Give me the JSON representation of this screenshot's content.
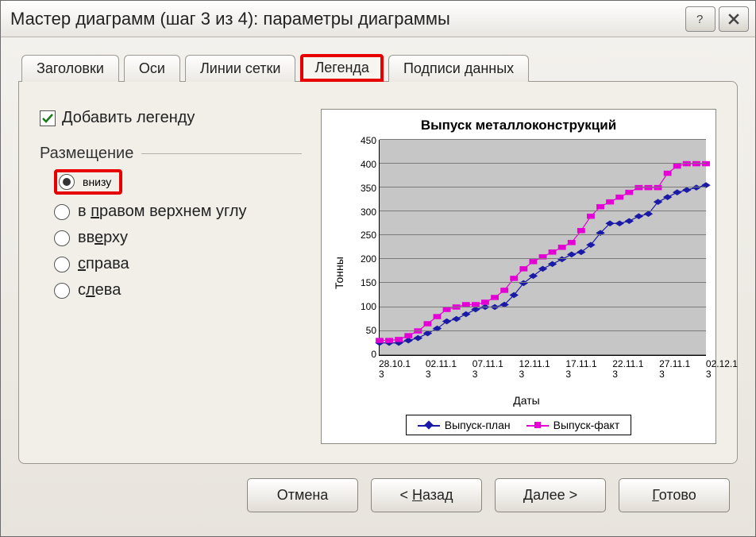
{
  "window": {
    "title": "Мастер диаграмм (шаг 3 из 4): параметры диаграммы"
  },
  "tabs": {
    "titles": "Заголовки",
    "axes": "Оси",
    "gridlines": "Линии сетки",
    "legend": "Легенда",
    "datalabels": "Подписи данных",
    "active": "legend"
  },
  "legendPanel": {
    "addLegend": "Добавить легенду",
    "placementLabel": "Размещение",
    "options": {
      "bottom": "внизу",
      "topRight": "в правом верхнем углу",
      "top": "вверху",
      "right": "справа",
      "left": "слева"
    },
    "selected": "bottom"
  },
  "chart_data": {
    "type": "line",
    "title": "Выпуск металлоконструкций",
    "xlabel": "Даты",
    "ylabel": "Тонны",
    "ylim": [
      0,
      450
    ],
    "yticks": [
      0,
      50,
      100,
      150,
      200,
      250,
      300,
      350,
      400,
      450
    ],
    "xticks": [
      "28.10.13",
      "02.11.13",
      "07.11.13",
      "12.11.13",
      "17.11.13",
      "22.11.13",
      "27.11.13",
      "02.12.13"
    ],
    "series": [
      {
        "name": "Выпуск-план",
        "color": "#1a1aa6",
        "marker": "diamond",
        "x": [
          0,
          1,
          2,
          3,
          4,
          5,
          6,
          7,
          8,
          9,
          10,
          11,
          12,
          13,
          14,
          15,
          16,
          17,
          18,
          19,
          20,
          21,
          22,
          23,
          24,
          25,
          26,
          27,
          28,
          29,
          30,
          31,
          32,
          33,
          34
        ],
        "y": [
          25,
          25,
          25,
          30,
          35,
          45,
          55,
          70,
          75,
          85,
          95,
          100,
          100,
          105,
          125,
          150,
          165,
          180,
          190,
          200,
          210,
          215,
          230,
          255,
          275,
          275,
          280,
          290,
          295,
          320,
          330,
          340,
          345,
          350,
          355
        ]
      },
      {
        "name": "Выпуск-факт",
        "color": "#e400d4",
        "marker": "square",
        "x": [
          0,
          1,
          2,
          3,
          4,
          5,
          6,
          7,
          8,
          9,
          10,
          11,
          12,
          13,
          14,
          15,
          16,
          17,
          18,
          19,
          20,
          21,
          22,
          23,
          24,
          25,
          26,
          27,
          28,
          29,
          30,
          31,
          32,
          33,
          34
        ],
        "y": [
          30,
          30,
          32,
          40,
          50,
          65,
          80,
          95,
          100,
          105,
          105,
          110,
          120,
          135,
          160,
          180,
          195,
          205,
          215,
          225,
          235,
          260,
          290,
          310,
          320,
          330,
          340,
          350,
          350,
          350,
          380,
          395,
          400,
          400,
          400
        ]
      }
    ],
    "legend_position": "bottom"
  },
  "buttons": {
    "cancel": "Отмена",
    "back": "< Назад",
    "next": "Далее >",
    "finish": "Готово"
  }
}
